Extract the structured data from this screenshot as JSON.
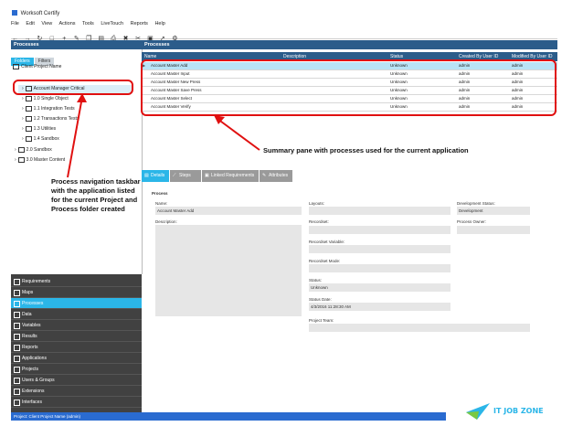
{
  "window": {
    "title": "Worksoft Certify"
  },
  "menu": [
    "File",
    "Edit",
    "View",
    "Actions",
    "Tools",
    "LiveTouch",
    "Reports",
    "Help"
  ],
  "toolbar_icons": [
    "back-icon",
    "forward-icon",
    "refresh-icon",
    "new-icon",
    "add-icon",
    "edit-icon",
    "copy-icon",
    "paste-icon",
    "print-icon",
    "delete-icon",
    "cut-icon",
    "save-icon",
    "run-icon",
    "settings-icon"
  ],
  "left_panel": {
    "header": "Processes",
    "tabs": [
      "Folders",
      "Filters"
    ],
    "tree": [
      "Client Project Name",
      "Account Manager Critical",
      "1.0 Single Object",
      "1.1 Integration Tests",
      "1.2 Transactions Tests",
      "1.3 Utilities",
      "1.4 Sandbox",
      "2.0 Sandbox",
      "3.0 Master Content"
    ],
    "annotation": "Process navigation taskbar with the application listed for the current Project and Process folder created"
  },
  "nav": [
    {
      "label": "Requirements",
      "icon": "requirements-icon"
    },
    {
      "label": "Maps",
      "icon": "maps-icon"
    },
    {
      "label": "Processes",
      "icon": "processes-icon",
      "active": true
    },
    {
      "label": "Data",
      "icon": "data-icon"
    },
    {
      "label": "Variables",
      "icon": "variables-icon"
    },
    {
      "label": "Results",
      "icon": "results-icon"
    },
    {
      "label": "Reports",
      "icon": "reports-icon"
    },
    {
      "label": "Applications",
      "icon": "applications-icon"
    },
    {
      "label": "Projects",
      "icon": "projects-icon"
    },
    {
      "label": "Users & Groups",
      "icon": "users-icon"
    },
    {
      "label": "Extensions",
      "icon": "extensions-icon"
    },
    {
      "label": "Interfaces",
      "icon": "interfaces-icon"
    }
  ],
  "status_bar": "Project: Client Project Name (admin)",
  "processes": {
    "header": "Processes",
    "columns": [
      "Name",
      "Description",
      "Status",
      "Created By User ID",
      "Modified By User ID"
    ],
    "rows": [
      [
        "Account Master Add",
        "",
        "Unknown",
        "admin",
        "admin"
      ],
      [
        "Account Master Input",
        "",
        "Unknown",
        "admin",
        "admin"
      ],
      [
        "Account Master New Press",
        "",
        "Unknown",
        "admin",
        "admin"
      ],
      [
        "Account Master Save Press",
        "",
        "Unknown",
        "admin",
        "admin"
      ],
      [
        "Account Master Select",
        "",
        "Unknown",
        "admin",
        "admin"
      ],
      [
        "Account Master Verify",
        "",
        "Unknown",
        "admin",
        "admin"
      ]
    ],
    "annotation": "Summary pane with processes used for the current application"
  },
  "details": {
    "tabs": [
      "Details",
      "Steps",
      "Linked Requirements",
      "Attributes"
    ],
    "section": "Process",
    "name_label": "Name:",
    "name_value": "Account Master Add",
    "description_label": "Description:",
    "layouts_label": "Layouts:",
    "recordset_label": "Recordset:",
    "recordset_variable_label": "Recordset Variable:",
    "recordset_mode_label": "Recordset Mode:",
    "status_label": "Status:",
    "status_value": "Unknown",
    "status_date_label": "Status Date:",
    "status_date_value": "4/3/2016 11:28:30 AM",
    "project_team_label": "Project Team:",
    "dev_status_label": "Development Status:",
    "dev_status_value": "Development",
    "process_owner_label": "Process Owner:"
  },
  "logo": {
    "text": "IT JOB ZONE"
  },
  "colors": {
    "accent": "#2bb6e8",
    "header": "#2b5c8a",
    "annotation": "#e01010",
    "nav": "#414141",
    "status": "#2a6bd0"
  }
}
